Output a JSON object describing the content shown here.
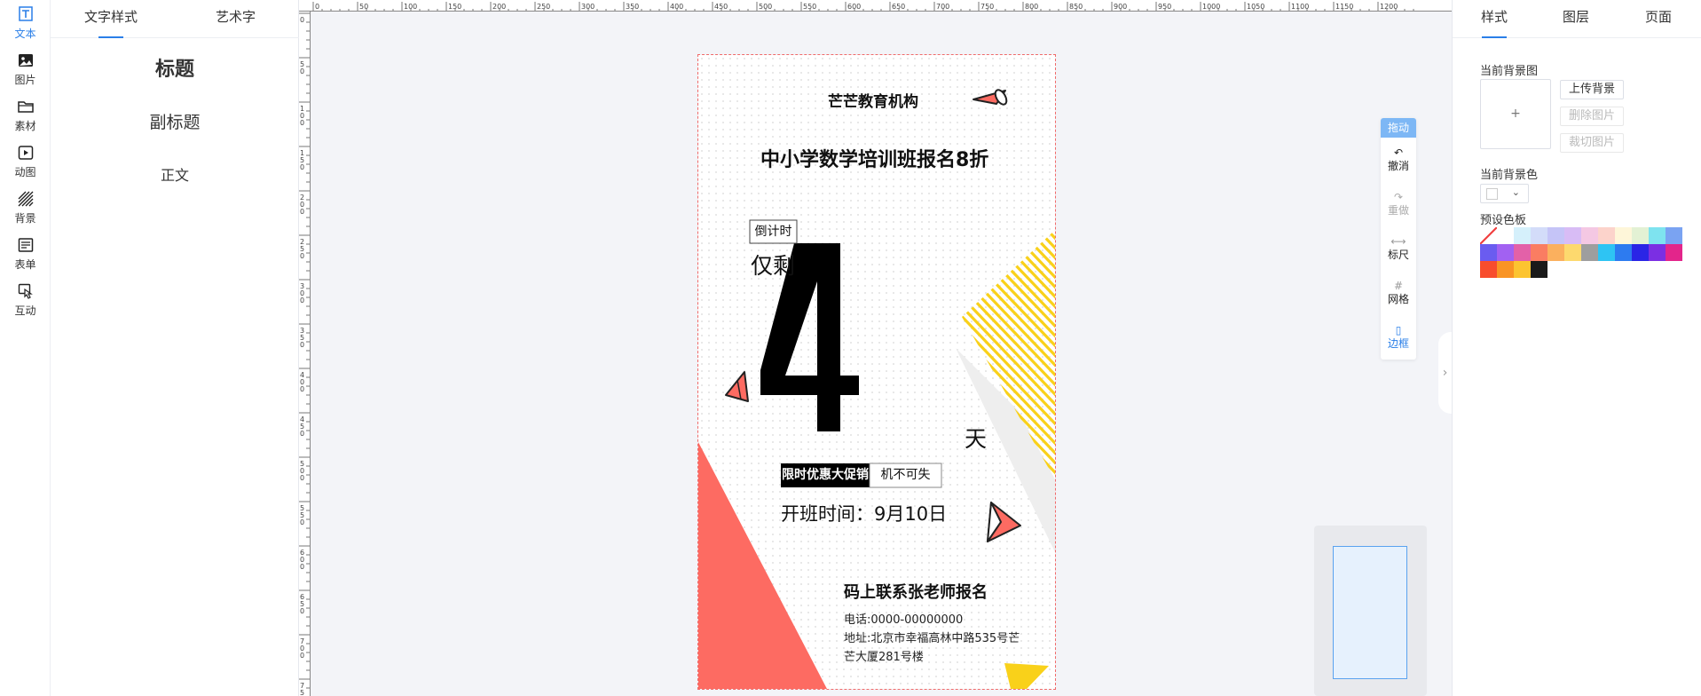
{
  "iconbar": {
    "items": [
      {
        "label": "文本",
        "icon": "text-icon"
      },
      {
        "label": "图片",
        "icon": "image-icon"
      },
      {
        "label": "素材",
        "icon": "folder-icon"
      },
      {
        "label": "动图",
        "icon": "animation-icon"
      },
      {
        "label": "背景",
        "icon": "background-icon"
      },
      {
        "label": "表单",
        "icon": "form-icon"
      },
      {
        "label": "互动",
        "icon": "interaction-icon"
      }
    ],
    "active_index": 0
  },
  "text_panel": {
    "tabs": [
      {
        "label": "文字样式"
      },
      {
        "label": "艺术字"
      }
    ],
    "active_tab": 0,
    "options": {
      "title": "标题",
      "subtitle": "副标题",
      "body": "正文"
    }
  },
  "ruler": {
    "top_labels": [
      "0",
      "50",
      "100",
      "150",
      "200",
      "250",
      "300",
      "350",
      "400",
      "450",
      "500",
      "550",
      "600",
      "650",
      "700",
      "750",
      "800",
      "850",
      "900",
      "950",
      "1000",
      "1050",
      "1100",
      "1150",
      "1200"
    ],
    "left_labels": [
      "0",
      "50",
      "100",
      "150",
      "200",
      "250",
      "300",
      "350",
      "400",
      "450",
      "500",
      "550",
      "600",
      "650",
      "700",
      "750"
    ]
  },
  "poster": {
    "org": "芒芒教育机构",
    "headline": "中小学数学培训班报名8折",
    "countdown_tag": "倒计时",
    "remaining": "仅剩",
    "big_number": "4",
    "day_unit": "天",
    "promo_left": "限时优惠大促销",
    "promo_right": "机不可失",
    "start_time": "开班时间：9月10日",
    "contact_title": "码上联系张老师报名",
    "phone": "电话:0000-00000000",
    "address_line1": "地址:北京市幸福高林中路535号芒",
    "address_line2": "芒大厦281号楼",
    "accent_colors": {
      "coral": "#fd6b62",
      "yellow": "#f9d11a",
      "black": "#000000"
    }
  },
  "toolbar": {
    "drag": "拖动",
    "items": [
      {
        "glyph": "↶",
        "label": "撤消",
        "icon": "undo-icon"
      },
      {
        "glyph": "↷",
        "label": "重做",
        "icon": "redo-icon"
      },
      {
        "glyph": "⟷",
        "label": "标尺",
        "icon": "ruler-icon"
      },
      {
        "glyph": "#",
        "label": "网格",
        "icon": "grid-icon"
      },
      {
        "glyph": "▯",
        "label": "边框",
        "icon": "border-icon"
      }
    ]
  },
  "collapse_handle": {
    "glyph": "›"
  },
  "right_panel": {
    "tabs": [
      {
        "label": "样式"
      },
      {
        "label": "图层"
      },
      {
        "label": "页面"
      }
    ],
    "active_tab": 0,
    "bg_image_label": "当前背景图",
    "upload_plus": "+",
    "buttons": {
      "upload": "上传背景",
      "delete": "删除图片",
      "crop": "裁切图片"
    },
    "bg_color_label": "当前背景色",
    "select_chevron": "⌄",
    "palette_label": "预设色板",
    "palette": [
      "none",
      "#ffffff",
      "#d5f0fb",
      "#d3dcf9",
      "#c5c4f7",
      "#d8bcf5",
      "#f4c8e3",
      "#fcd3cb",
      "#fef6d9",
      "#e3f1d4",
      "#7ee3ef",
      "#7aa3f2",
      "#6a5cf0",
      "#a261f2",
      "#e361a8",
      "#fa7d62",
      "#fbb05e",
      "#fdd96e",
      "#9e9e9e",
      "#2ec4f3",
      "#2d7bf0",
      "#2a25e6",
      "#7b2fe3",
      "#e3258b",
      "#f84d2d",
      "#f99424",
      "#fcc430",
      "#1a1a1a"
    ]
  }
}
